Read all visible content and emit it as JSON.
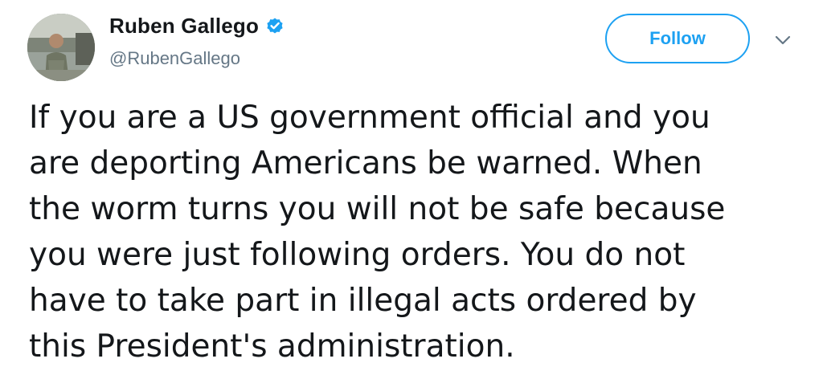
{
  "author": {
    "display_name": "Ruben Gallego",
    "handle": "@RubenGallego",
    "verified": true,
    "avatar_icon": "profile-photo"
  },
  "actions": {
    "follow_label": "Follow",
    "more_icon": "chevron-down-icon"
  },
  "tweet": {
    "lines": [
      "If you are a US government official and you",
      "are deporting Americans be warned. When",
      "the worm turns you will not be safe because",
      "you were just following orders. You do not",
      "have to take part in illegal acts ordered by",
      "this President's administration."
    ]
  },
  "colors": {
    "accent": "#1da1f2",
    "text": "#14171a",
    "secondary_text": "#657786"
  }
}
